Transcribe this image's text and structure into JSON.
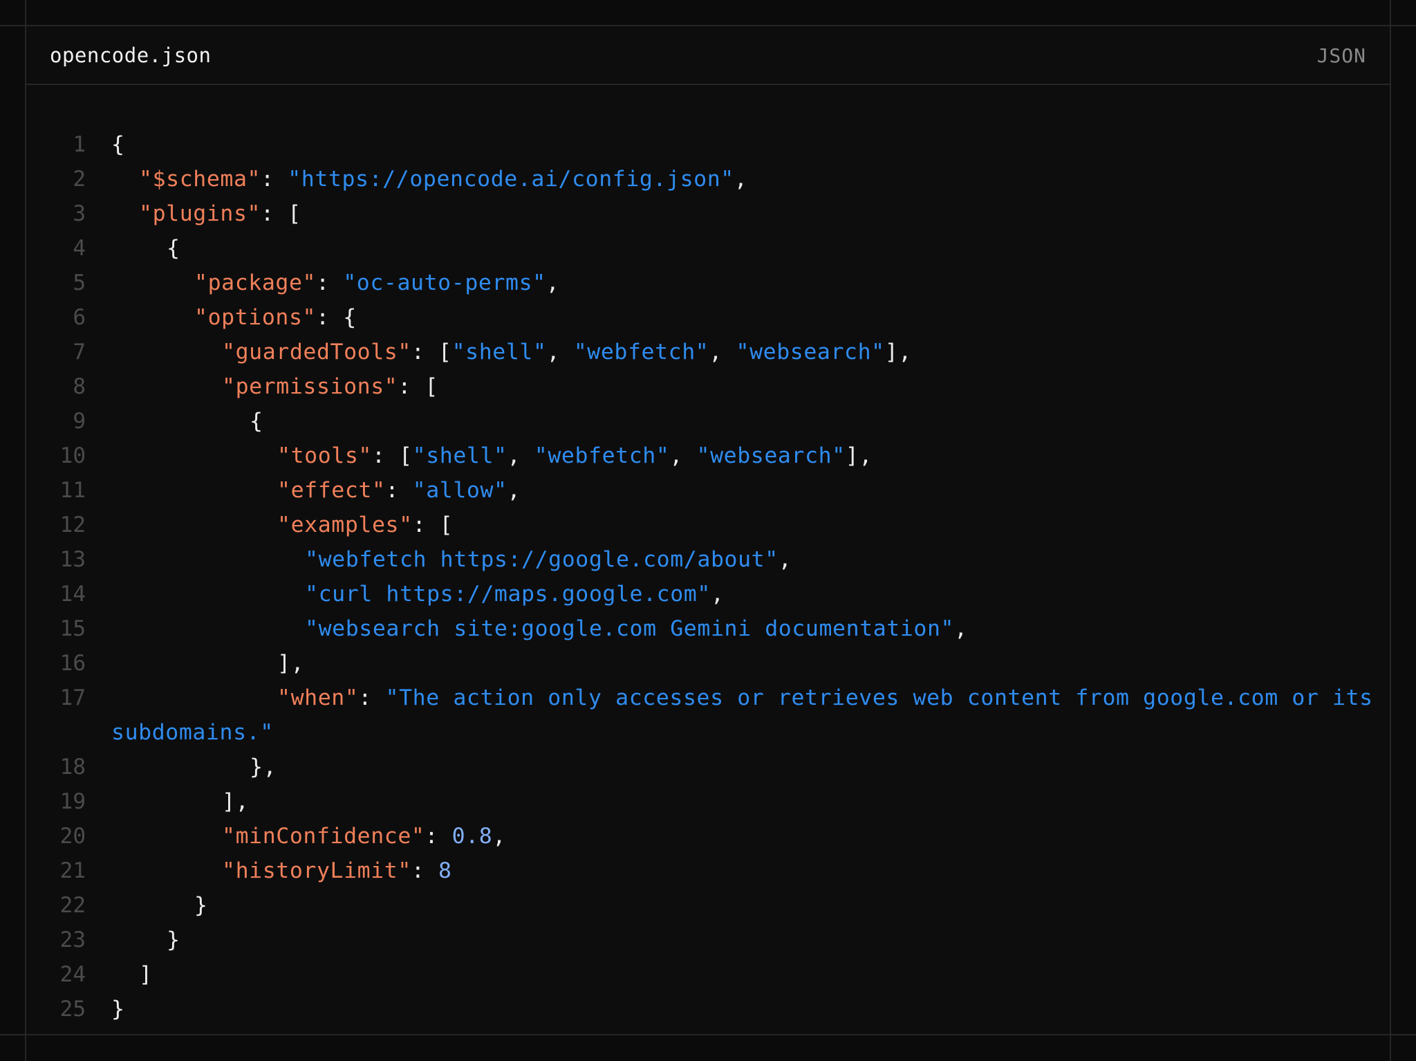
{
  "file": {
    "name": "opencode.json",
    "language": "JSON"
  },
  "colors": {
    "key": "#f0805a",
    "string": "#2f8cf0",
    "number": "#82aef5",
    "punct": "#ededed",
    "line_number": "#4b4b4b"
  },
  "code_lines": [
    {
      "num": "1",
      "indent": 0,
      "tokens": [
        [
          "p",
          "{"
        ]
      ]
    },
    {
      "num": "2",
      "indent": 1,
      "tokens": [
        [
          "k",
          "\"$schema\""
        ],
        [
          "p",
          ": "
        ],
        [
          "s",
          "\"https://opencode.ai/config.json\""
        ],
        [
          "p",
          ","
        ]
      ]
    },
    {
      "num": "3",
      "indent": 1,
      "tokens": [
        [
          "k",
          "\"plugins\""
        ],
        [
          "p",
          ": ["
        ]
      ]
    },
    {
      "num": "4",
      "indent": 2,
      "tokens": [
        [
          "p",
          "{"
        ]
      ]
    },
    {
      "num": "5",
      "indent": 3,
      "tokens": [
        [
          "k",
          "\"package\""
        ],
        [
          "p",
          ": "
        ],
        [
          "s",
          "\"oc-auto-perms\""
        ],
        [
          "p",
          ","
        ]
      ]
    },
    {
      "num": "6",
      "indent": 3,
      "tokens": [
        [
          "k",
          "\"options\""
        ],
        [
          "p",
          ": {"
        ]
      ]
    },
    {
      "num": "7",
      "indent": 4,
      "tokens": [
        [
          "k",
          "\"guardedTools\""
        ],
        [
          "p",
          ": ["
        ],
        [
          "s",
          "\"shell\""
        ],
        [
          "p",
          ", "
        ],
        [
          "s",
          "\"webfetch\""
        ],
        [
          "p",
          ", "
        ],
        [
          "s",
          "\"websearch\""
        ],
        [
          "p",
          "],"
        ]
      ]
    },
    {
      "num": "8",
      "indent": 4,
      "tokens": [
        [
          "k",
          "\"permissions\""
        ],
        [
          "p",
          ": ["
        ]
      ]
    },
    {
      "num": "9",
      "indent": 5,
      "tokens": [
        [
          "p",
          "{"
        ]
      ]
    },
    {
      "num": "10",
      "indent": 6,
      "tokens": [
        [
          "k",
          "\"tools\""
        ],
        [
          "p",
          ": ["
        ],
        [
          "s",
          "\"shell\""
        ],
        [
          "p",
          ", "
        ],
        [
          "s",
          "\"webfetch\""
        ],
        [
          "p",
          ", "
        ],
        [
          "s",
          "\"websearch\""
        ],
        [
          "p",
          "],"
        ]
      ]
    },
    {
      "num": "11",
      "indent": 6,
      "tokens": [
        [
          "k",
          "\"effect\""
        ],
        [
          "p",
          ": "
        ],
        [
          "s",
          "\"allow\""
        ],
        [
          "p",
          ","
        ]
      ]
    },
    {
      "num": "12",
      "indent": 6,
      "tokens": [
        [
          "k",
          "\"examples\""
        ],
        [
          "p",
          ": ["
        ]
      ]
    },
    {
      "num": "13",
      "indent": 7,
      "tokens": [
        [
          "s",
          "\"webfetch https://google.com/about\""
        ],
        [
          "p",
          ","
        ]
      ]
    },
    {
      "num": "14",
      "indent": 7,
      "tokens": [
        [
          "s",
          "\"curl https://maps.google.com\""
        ],
        [
          "p",
          ","
        ]
      ]
    },
    {
      "num": "15",
      "indent": 7,
      "tokens": [
        [
          "s",
          "\"websearch site:google.com Gemini documentation\""
        ],
        [
          "p",
          ","
        ]
      ]
    },
    {
      "num": "16",
      "indent": 6,
      "tokens": [
        [
          "p",
          "],"
        ]
      ]
    },
    {
      "num": "17",
      "indent": 6,
      "wrap": true,
      "tokens": [
        [
          "k",
          "\"when\""
        ],
        [
          "p",
          ": "
        ],
        [
          "s",
          "\"The action only accesses or retrieves web content from google.com or its subdomains.\""
        ]
      ]
    },
    {
      "num": "18",
      "indent": 5,
      "tokens": [
        [
          "p",
          "},"
        ]
      ]
    },
    {
      "num": "19",
      "indent": 4,
      "tokens": [
        [
          "p",
          "],"
        ]
      ]
    },
    {
      "num": "20",
      "indent": 4,
      "tokens": [
        [
          "k",
          "\"minConfidence\""
        ],
        [
          "p",
          ": "
        ],
        [
          "n",
          "0.8"
        ],
        [
          "p",
          ","
        ]
      ]
    },
    {
      "num": "21",
      "indent": 4,
      "tokens": [
        [
          "k",
          "\"historyLimit\""
        ],
        [
          "p",
          ": "
        ],
        [
          "n",
          "8"
        ]
      ]
    },
    {
      "num": "22",
      "indent": 3,
      "tokens": [
        [
          "p",
          "}"
        ]
      ]
    },
    {
      "num": "23",
      "indent": 2,
      "tokens": [
        [
          "p",
          "}"
        ]
      ]
    },
    {
      "num": "24",
      "indent": 1,
      "tokens": [
        [
          "p",
          "]"
        ]
      ]
    },
    {
      "num": "25",
      "indent": 0,
      "tokens": [
        [
          "p",
          "}"
        ]
      ]
    }
  ]
}
